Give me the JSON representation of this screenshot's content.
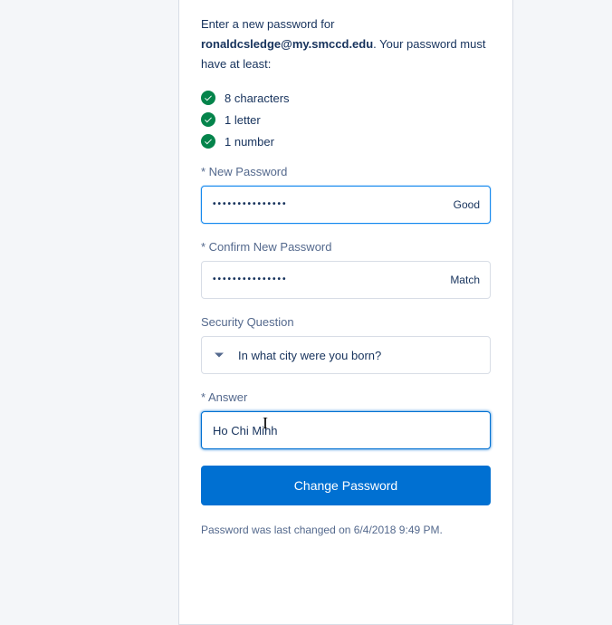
{
  "intro": {
    "prefix": "Enter a new password for ",
    "email": "ronaldcsledge@my.smccd.edu",
    "suffix": ". Your password must have at least:"
  },
  "requirements": [
    "8 characters",
    "1 letter",
    "1 number"
  ],
  "labels": {
    "new_password": "* New Password",
    "confirm_password": "* Confirm New Password",
    "security_question": "Security Question",
    "answer": "* Answer"
  },
  "fields": {
    "new_password_mask": "•••••••••••••••",
    "new_password_status": "Good",
    "confirm_password_mask": "•••••••••••••••",
    "confirm_password_status": "Match",
    "security_question_value": "In what city were you born?",
    "answer_value": "Ho Chi Minh"
  },
  "button": {
    "label": "Change Password"
  },
  "footnote": "Password was last changed on 6/4/2018 9:49 PM."
}
